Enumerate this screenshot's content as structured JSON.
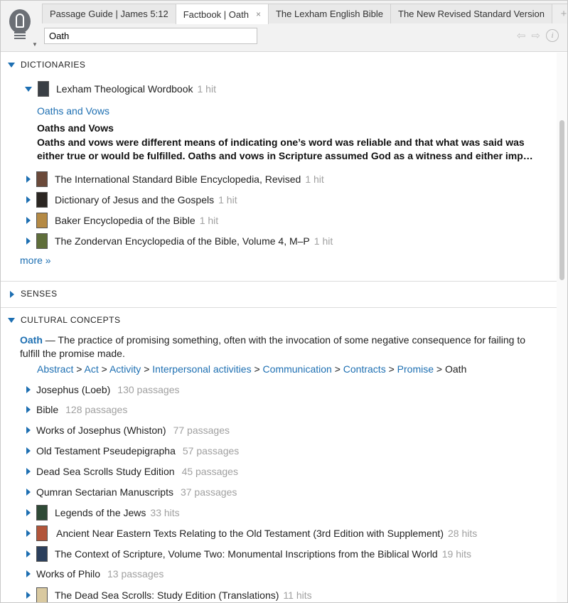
{
  "tabs": [
    {
      "label": "Passage Guide | James 5:12",
      "active": false
    },
    {
      "label": "Factbook | Oath",
      "active": true,
      "close": "×"
    },
    {
      "label": "The Lexham English Bible",
      "active": false
    },
    {
      "label": "The New Revised Standard Version",
      "active": false
    }
  ],
  "tab_add": "+",
  "search": {
    "value": "Oath"
  },
  "nav": {
    "back": "⇦",
    "forward": "⇨",
    "info": "i"
  },
  "sections": {
    "dictionaries": "DICTIONARIES",
    "senses": "SENSES",
    "cultural": "CULTURAL CONCEPTS"
  },
  "dictionaries": {
    "expanded": {
      "title": "Lexham Theological Wordbook",
      "count": "1 hit"
    },
    "article_link": "Oaths and Vows",
    "article_heading": "Oaths and Vows",
    "article_text": "Oaths and vows were different means of indicating one’s word was reliable and that what was said was either true or would be fulfilled. Oaths and vows in Scripture assumed God as a witness and either imp…",
    "items": [
      {
        "title": "The International Standard Bible Encyclopedia, Revised",
        "count": "1 hit"
      },
      {
        "title": "Dictionary of Jesus and the Gospels",
        "count": "1 hit"
      },
      {
        "title": "Baker Encyclopedia of the Bible",
        "count": "1 hit"
      },
      {
        "title": "The Zondervan Encyclopedia of the Bible, Volume 4, M–P",
        "count": "1 hit"
      }
    ],
    "more": "more »"
  },
  "cultural": {
    "term": "Oath",
    "definition": " — The practice of promising something, often with the invocation of some negative consequence for failing to fulfill the promise made.",
    "breadcrumb": [
      "Abstract",
      "Act",
      "Activity",
      "Interpersonal activities",
      "Communication",
      "Contracts",
      "Promise"
    ],
    "breadcrumb_sep": " > ",
    "breadcrumb_current": "Oath",
    "items": [
      {
        "title": "Josephus (Loeb)",
        "count": "130 passages"
      },
      {
        "title": "Bible",
        "count": "128 passages"
      },
      {
        "title": "Works of Josephus (Whiston)",
        "count": "77 passages"
      },
      {
        "title": "Old Testament Pseudepigrapha",
        "count": "57 passages"
      },
      {
        "title": "Dead Sea Scrolls Study Edition",
        "count": "45 passages"
      },
      {
        "title": "Qumran Sectarian Manuscripts",
        "count": "37 passages"
      },
      {
        "title": "Legends of the Jews",
        "count": "33 hits"
      },
      {
        "title": "Ancient Near Eastern Texts Relating to the Old Testament (3rd Edition with Supplement)",
        "count": "28 hits"
      },
      {
        "title": "The Context of Scripture, Volume Two: Monumental Inscriptions from the Biblical World",
        "count": "19 hits"
      },
      {
        "title": "Works of Philo",
        "count": "13 passages"
      },
      {
        "title": "The Dead Sea Scrolls: Study Edition (Translations)",
        "count": "11 hits"
      }
    ]
  },
  "colors": {
    "link": "#1d6fb2",
    "count": "#a0a0a0"
  }
}
